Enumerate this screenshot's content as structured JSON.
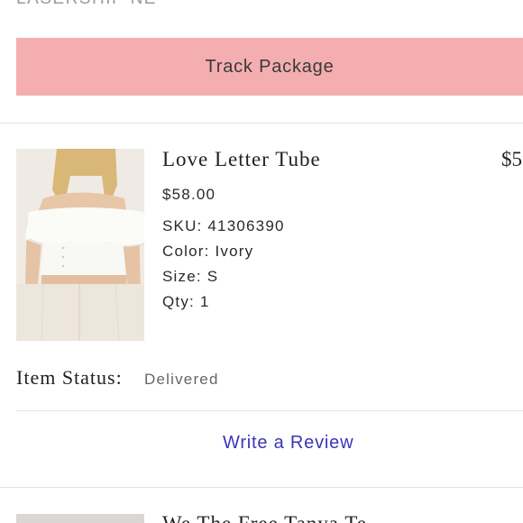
{
  "shipment": {
    "carrier_label": "LASERSHIP NE",
    "track_button_label": "Track Package"
  },
  "order_item": {
    "name": "Love Letter Tube",
    "row_total": "$5",
    "price": "$58.00",
    "sku": "SKU: 41306390",
    "color": "Color: Ivory",
    "size": "Size: S",
    "qty": "Qty: 1",
    "image_icon": "product-photo-off-shoulder-top",
    "status_label": "Item Status:",
    "status_value": "Delivered",
    "review_link_label": "Write a Review"
  },
  "next_item": {
    "name_partial": "We The Free Tanya Te"
  },
  "colors": {
    "track_button_bg": "#f4aeb0",
    "link": "#3b35b8",
    "muted_text": "#9a9a9a"
  }
}
